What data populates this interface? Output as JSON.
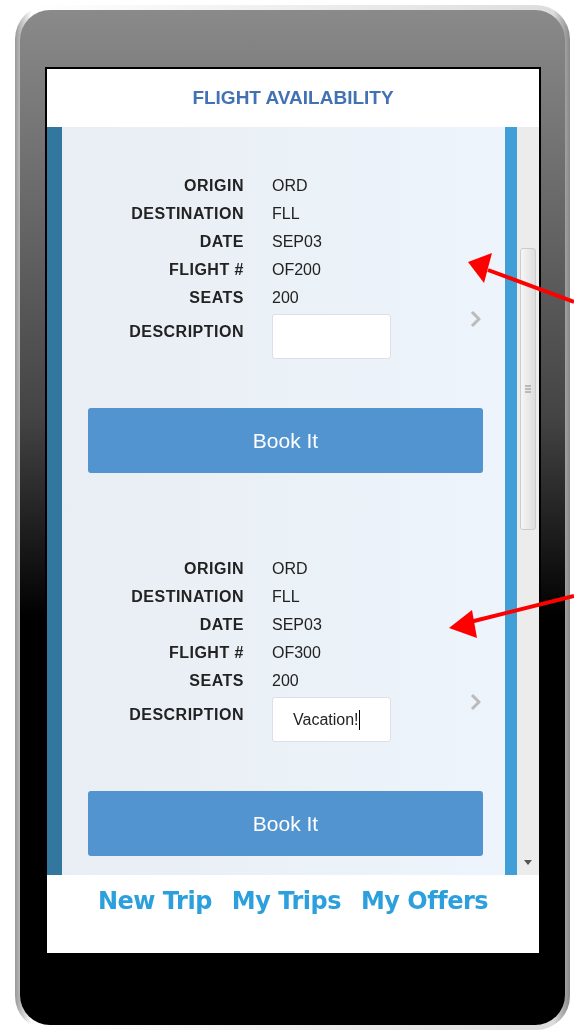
{
  "header": {
    "title": "FLIGHT AVAILABILITY"
  },
  "flights": [
    {
      "fields": [
        {
          "label": "ORIGIN",
          "value": "ORD"
        },
        {
          "label": "DESTINATION",
          "value": "FLL"
        },
        {
          "label": "DATE",
          "value": "SEP03"
        },
        {
          "label": "FLIGHT #",
          "value": "OF200"
        },
        {
          "label": "SEATS",
          "value": "200"
        }
      ],
      "description": {
        "label": "DESCRIPTION",
        "focused": false
      },
      "button": "Book It"
    },
    {
      "fields": [
        {
          "label": "ORIGIN",
          "value": "ORD"
        },
        {
          "label": "DESTINATION",
          "value": "FLL"
        },
        {
          "label": "DATE",
          "value": "SEP03"
        },
        {
          "label": "FLIGHT #",
          "value": "OF300"
        },
        {
          "label": "SEATS",
          "value": "200"
        }
      ],
      "description": {
        "label": "DESCRIPTION",
        "value": "Vacation!",
        "focused": true
      },
      "button": "Book It"
    }
  ],
  "nav": [
    {
      "label": "New Trip"
    },
    {
      "label": "My Trips"
    },
    {
      "label": "My Offers"
    }
  ]
}
